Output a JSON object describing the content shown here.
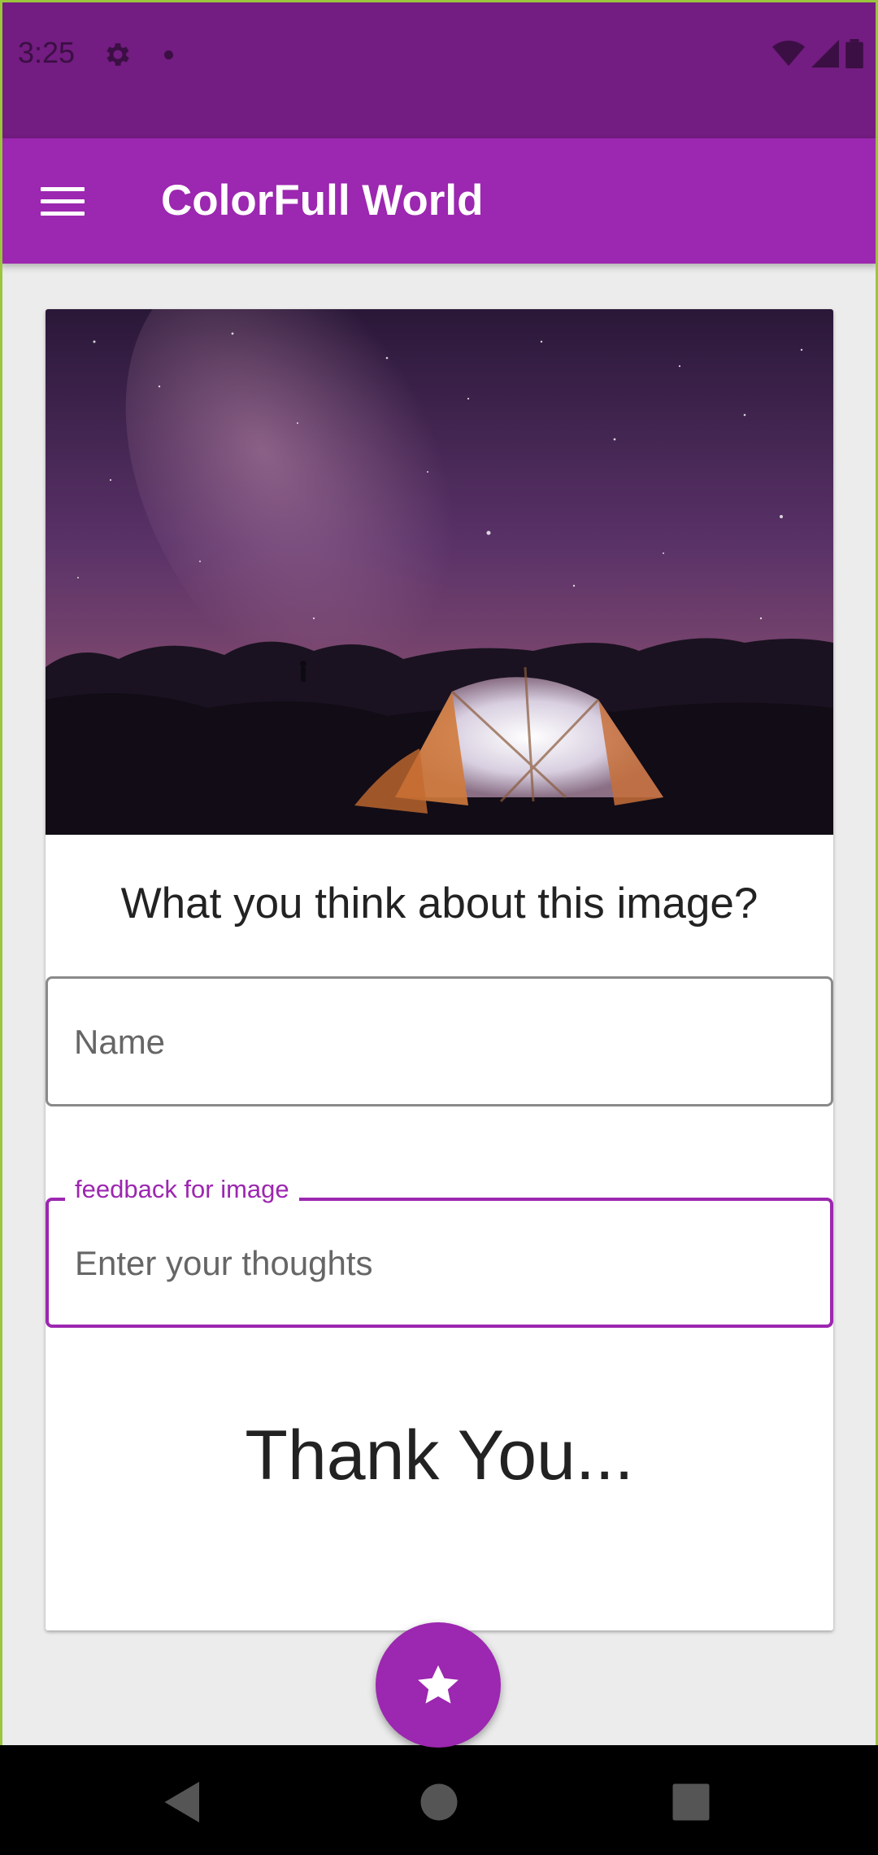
{
  "status_bar": {
    "time": "3:25"
  },
  "app_bar": {
    "title": "ColorFull World"
  },
  "card": {
    "question": "What you think about this image?",
    "name_field": {
      "placeholder": "Name",
      "value": ""
    },
    "feedback_field": {
      "label": "feedback for image",
      "placeholder": "Enter your thoughts",
      "value": ""
    },
    "thanks_text": "Thank You..."
  },
  "colors": {
    "primary": "#9c27b0",
    "primary_dark": "#731c81"
  },
  "icons": [
    "gear-icon",
    "wifi-icon",
    "signal-icon",
    "battery-icon",
    "menu-icon",
    "star-icon",
    "back-icon",
    "home-icon",
    "recents-icon"
  ]
}
